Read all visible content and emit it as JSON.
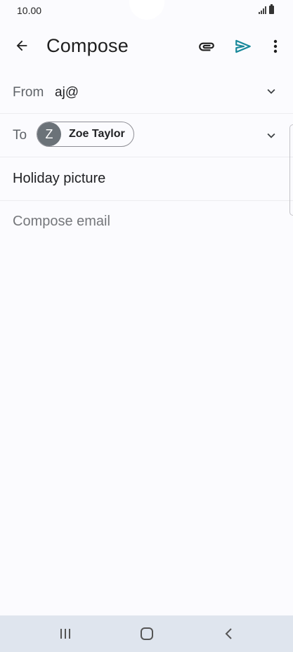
{
  "status_bar": {
    "time": "10.00"
  },
  "app_bar": {
    "title": "Compose"
  },
  "from_field": {
    "label": "From",
    "value": "aj@"
  },
  "to_field": {
    "label": "To",
    "recipient": {
      "initial": "Z",
      "name": "Zoe Taylor"
    }
  },
  "subject": {
    "value": "Holiday picture"
  },
  "body": {
    "placeholder": "Compose email"
  },
  "colors": {
    "send_accent": "#17889a",
    "avatar_bg": "#6b7278",
    "background": "#fbfbfe",
    "nav_bar": "#dfe5ee"
  },
  "icons": {
    "back": "arrow-left-icon",
    "attach": "paperclip-icon",
    "send": "send-icon",
    "more": "more-vertical-icon",
    "expand": "chevron-down-icon",
    "recents": "recents-icon",
    "home": "home-icon",
    "nav_back": "chevron-left-icon"
  }
}
